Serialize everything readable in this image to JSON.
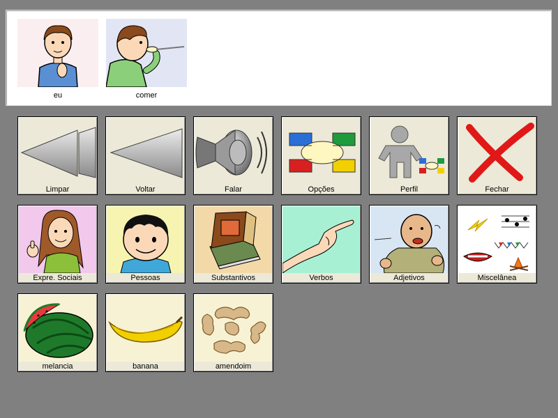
{
  "sentence": {
    "items": [
      {
        "label": "eu",
        "icon": "boy-pointing-self"
      },
      {
        "label": "comer",
        "icon": "boy-eating-spoon"
      }
    ]
  },
  "board": {
    "rows": [
      [
        {
          "label": "Limpar",
          "icon": "rewind-icon"
        },
        {
          "label": "Voltar",
          "icon": "back-arrow-icon"
        },
        {
          "label": "Falar",
          "icon": "speaker-icon"
        },
        {
          "label": "Opções",
          "icon": "options-icon"
        },
        {
          "label": "Perfil",
          "icon": "profile-icon"
        },
        {
          "label": "Fechar",
          "icon": "close-x-icon"
        }
      ],
      [
        {
          "label": "Expre. Sociais",
          "icon": "thumbs-up-girl-icon"
        },
        {
          "label": "Pessoas",
          "icon": "boy-face-icon"
        },
        {
          "label": "Substantivos",
          "icon": "book-icon"
        },
        {
          "label": "Verbos",
          "icon": "pointing-hand-icon"
        },
        {
          "label": "Adjetivos",
          "icon": "tired-man-icon"
        },
        {
          "label": "Miscelânea",
          "icon": "misc-collage-icon"
        }
      ],
      [
        {
          "label": "melancia",
          "icon": "watermelon-icon"
        },
        {
          "label": "banana",
          "icon": "banana-icon"
        },
        {
          "label": "amendoim",
          "icon": "peanuts-icon"
        }
      ]
    ]
  }
}
